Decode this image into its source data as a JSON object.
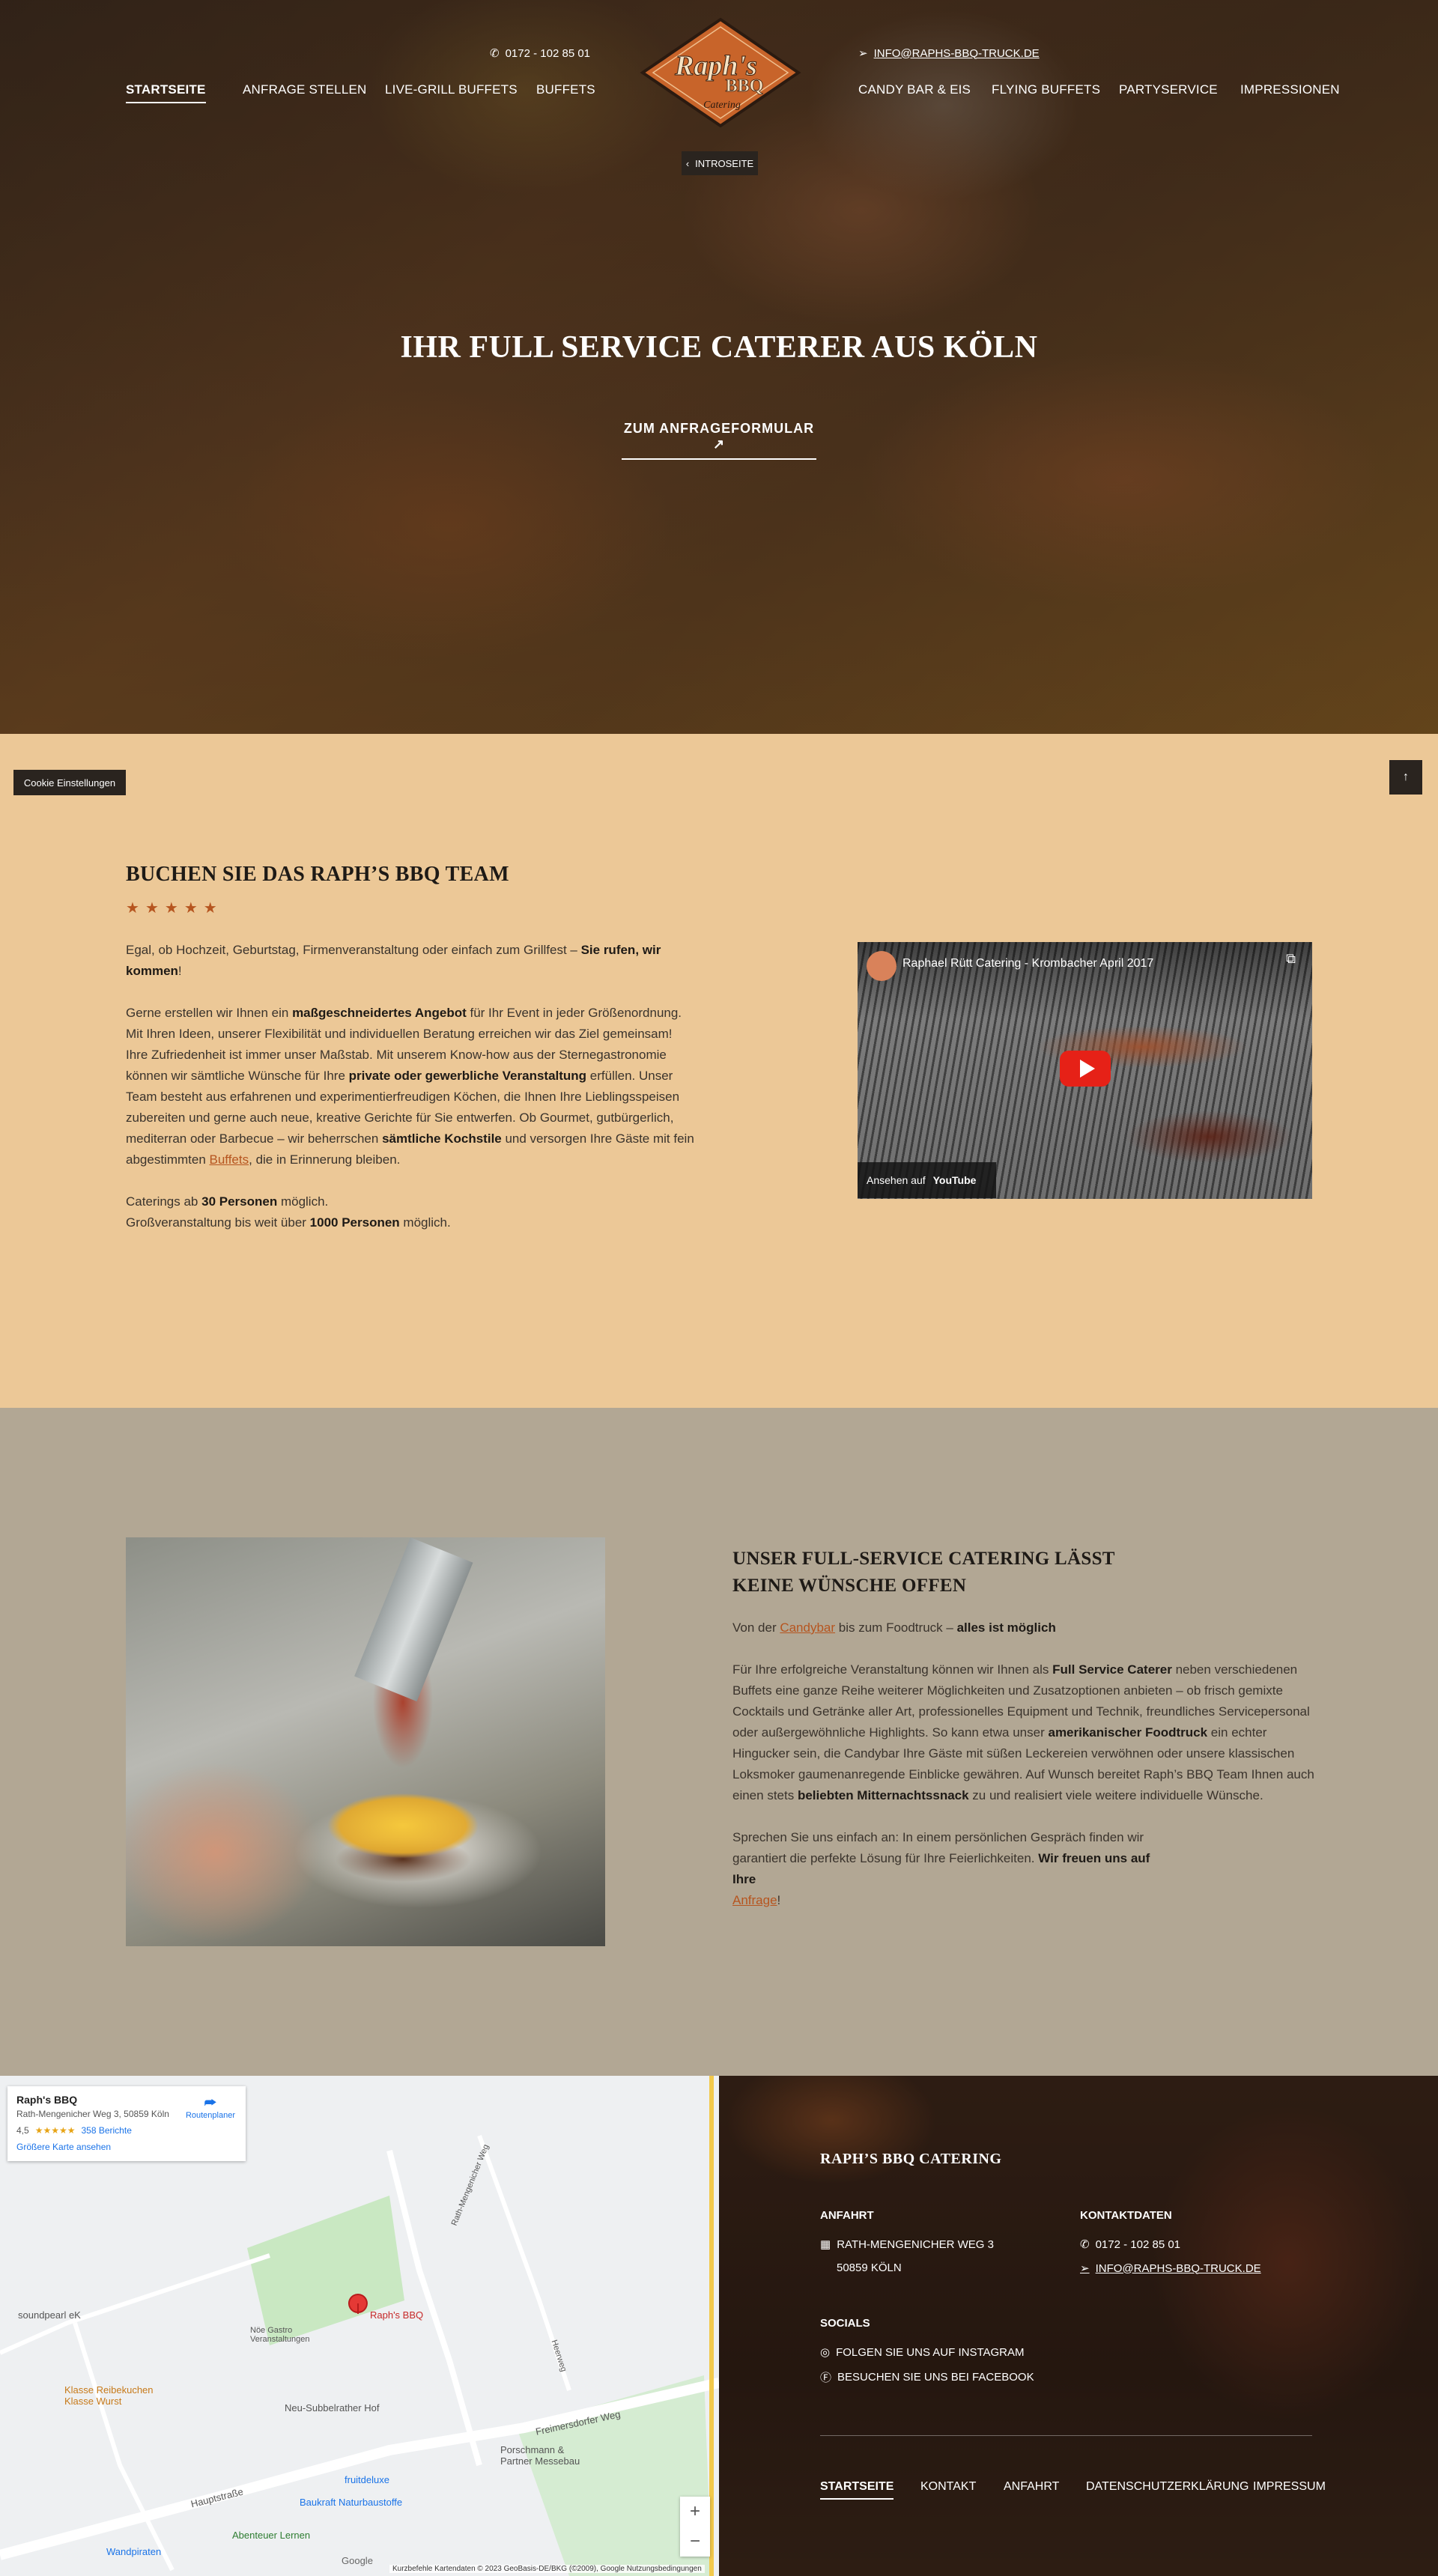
{
  "header": {
    "phone": "0172 - 102 85 01",
    "email": "INFO@RAPHS-BBQ-TRUCK.DE",
    "logo_text": "Raph's BBQ",
    "logo_sub": "Catering",
    "nav_left": [
      "STARTSEITE",
      "ANFRAGE STELLEN",
      "LIVE-GRILL BUFFETS",
      "BUFFETS"
    ],
    "nav_right": [
      "CANDY BAR & EIS",
      "FLYING BUFFETS",
      "PARTYSERVICE",
      "IMPRESSIONEN"
    ],
    "intro_button": "INTROSEITE"
  },
  "hero": {
    "title": "IHR FULL SERVICE CATERER AUS KÖLN",
    "cta": "ZUM ANFRAGEFORMULAR"
  },
  "utility": {
    "cookie_button": "Cookie Einstellungen",
    "top_button": "↑"
  },
  "book": {
    "title": "BUCHEN SIE DAS RAPH’S BBQ TEAM",
    "rating": 5,
    "p1_a": "Egal, ob Hochzeit, Geburtstag, Firmenveranstaltung oder einfach zum Grillfest – ",
    "p1_b": "Sie rufen, wir kommen",
    "p1_c": "!",
    "p2_a": "Gerne erstellen wir Ihnen ein ",
    "p2_b": "maßgeschneidertes Angebot",
    "p2_c": " für Ihr Event in jeder Größenordnung. Mit Ihren Ideen, unserer Flexibilität und individuellen Beratung erreichen wir das Ziel gemeinsam! Ihre Zufriedenheit ist immer unser Maßstab. Mit unserem Know-how aus der Sternegastronomie können wir sämtliche Wünsche für Ihre ",
    "p2_d": "private oder gewerbliche Veranstaltung",
    "p2_e": " erfüllen. Unser Team besteht aus erfahrenen und experimentierfreudigen Köchen, die Ihnen Ihre Lieblingsspeisen zubereiten und gerne auch neue, kreative Gerichte für Sie entwerfen. Ob Gourmet, gutbürgerlich, mediterran oder Barbecue – wir beherrschen ",
    "p2_f": "sämtliche Kochstile",
    "p2_g": " und versorgen Ihre Gäste mit fein abgestimmten ",
    "p2_link": "Buffets",
    "p2_h": ", die in Erinnerung bleiben.",
    "p3_a": "Caterings ab ",
    "p3_b": "30 Personen",
    "p3_c": " möglich.",
    "p4_a": "Großveranstaltung bis weit über ",
    "p4_b": "1000 Personen",
    "p4_c": " möglich.",
    "video_title": "Raphael Rütt Catering - Krombacher April 2017",
    "video_watch": "Ansehen auf",
    "video_brand": "YouTube"
  },
  "service": {
    "title_line1": "UNSER FULL-SERVICE CATERING LÄSST",
    "title_line2": "KEINE WÜNSCHE OFFEN",
    "p1_a": "Von der ",
    "p1_link": "Candybar",
    "p1_b": " bis zum Foodtruck – ",
    "p1_c": "alles ist möglich",
    "p2_a": "Für Ihre erfolgreiche Veranstaltung können wir Ihnen als ",
    "p2_b": "Full Service Caterer",
    "p2_c": " neben verschiedenen Buffets eine ganze Reihe weiterer Möglichkeiten und Zusatzoptionen anbieten – ob frisch gemixte Cocktails und Getränke aller Art, professionelles Equipment und Technik, freundliches Servicepersonal oder außergewöhnliche Highlights. So kann etwa unser ",
    "p2_d": "amerikanischer Foodtruck",
    "p2_e": " ein echter Hingucker sein, die Candybar Ihre Gäste mit süßen Leckereien verwöhnen oder unsere klassischen Loksmoker gaumenanregende Einblicke gewähren. Auf Wunsch bereitet Raph’s BBQ Team Ihnen auch einen stets ",
    "p2_f": "beliebten Mitternachtssnack",
    "p2_g": " zu und realisiert viele weitere individuelle Wünsche.",
    "p3_a": "Sprechen Sie uns einfach an: In einem persönlichen Gespräch finden wir garantiert die perfekte Lösung für Ihre Feierlichkeiten. ",
    "p3_b": "Wir freuen uns auf Ihre",
    "p3_link": "Anfrage",
    "p3_c": "!"
  },
  "map": {
    "place": "Raph's BBQ",
    "address": "Rath-Mengenicher Weg 3, 50859 Köln",
    "rating": "4,5",
    "stars": "★★★★★",
    "reviews": "358 Berichte",
    "larger_map": "Größere Karte ansehen",
    "route": "Routenplaner",
    "labels": [
      "soundpearl eK",
      "Klasse Reibekuchen Klasse Wurst",
      "Nöe Gastro Veranstaltungen",
      "Raph's BBQ",
      "Neu-Subbelrather Hof",
      "Freimersdorfer Weg",
      "Porschmann & Partner Messebau",
      "Hauptstraße",
      "fruitdeluxe",
      "Baukraft Naturbaustoffe",
      "Abenteuer Lernen",
      "Wandpiraten",
      "Rath-Mengenicher Weg",
      "Heerweg"
    ],
    "attribution": "Kurzbefehle   Kartendaten © 2023 GeoBasis-DE/BKG (©2009), Google   Nutzungsbedingungen",
    "google": "Google"
  },
  "footer": {
    "title": "RAPH’S BBQ CATERING",
    "anfahrt_h": "ANFAHRT",
    "street": "RATH-MENGENICHER WEG 3",
    "city": "50859 KÖLN",
    "kontakt_h": "KONTAKTDATEN",
    "phone": "0172 - 102 85 01",
    "email": "INFO@RAPHS-BBQ-TRUCK.DE",
    "socials_h": "SOCIALS",
    "instagram": "FOLGEN SIE UNS AUF INSTAGRAM",
    "facebook": "BESUCHEN SIE UNS BEI FACEBOOK",
    "nav": [
      "STARTSEITE",
      "KONTAKT",
      "ANFAHRT",
      "DATENSCHUTZERKLÄRUNG",
      "IMPRESSUM"
    ]
  },
  "colors": {
    "accent": "#b6551f",
    "beige": "#ecc897",
    "taupe": "#b2a794",
    "dark": "#2a241f"
  }
}
